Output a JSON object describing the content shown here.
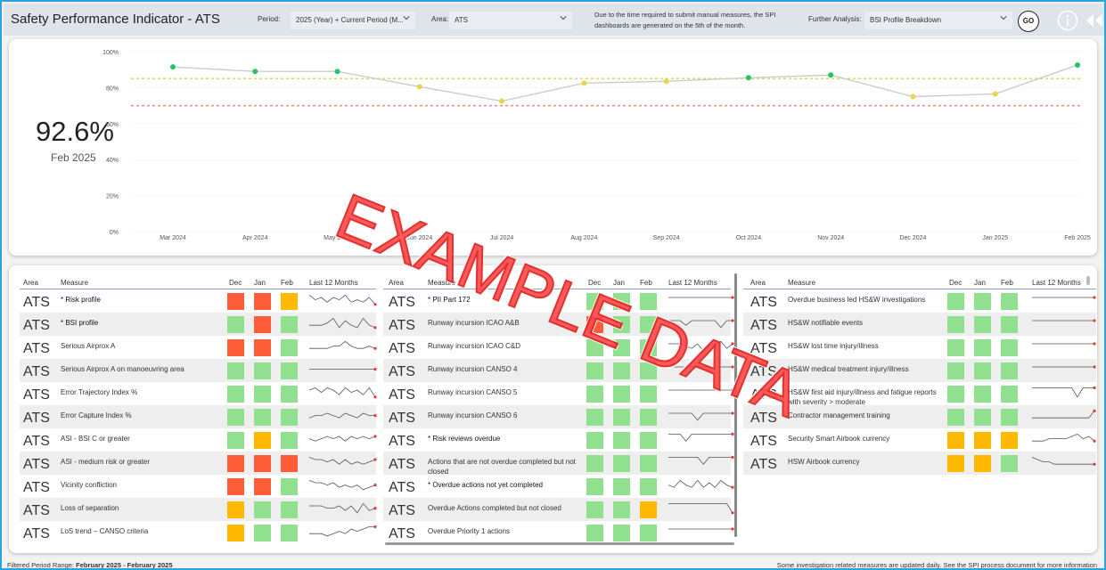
{
  "header": {
    "title": "Safety Performance Indicator  - ATS",
    "period_label": "Period:",
    "period_value": "2025 (Year) + Current Period (M...",
    "area_label": "Area:",
    "area_value": "ATS",
    "note": "Due to the time required to submit manual measures, the SPI dashboards are generated on the 5th of the month.",
    "further_label": "Further Analysis:",
    "further_value": "BSI Profile Breakdown",
    "go_label": "GO"
  },
  "kpi": {
    "value": "92.6%",
    "period": "Feb 2025"
  },
  "chart_data": {
    "type": "line",
    "categories": [
      "Mar 2024",
      "Apr 2024",
      "May 2024",
      "Jun 2024",
      "Jul 2024",
      "Aug 2024",
      "Sep 2024",
      "Oct 2024",
      "Nov 2024",
      "Dec 2024",
      "Jan 2025",
      "Feb 2025"
    ],
    "values": [
      91.5,
      89.0,
      89.0,
      80.5,
      72.5,
      82.5,
      83.5,
      85.5,
      87.0,
      75.0,
      76.5,
      92.6
    ],
    "point_colors": [
      "#22c55e",
      "#22c55e",
      "#22c55e",
      "#e8d44d",
      "#e8d44d",
      "#e8d44d",
      "#e8d44d",
      "#22c55e",
      "#22c55e",
      "#e8d44d",
      "#e8d44d",
      "#22c55e"
    ],
    "ylim": [
      0,
      100
    ],
    "yticks": [
      "0%",
      "20%",
      "40%",
      "60%",
      "80%",
      "100%"
    ],
    "target_lines": [
      {
        "value": 85,
        "color": "#d6d95a"
      },
      {
        "value": 70,
        "color": "#f08a7a"
      }
    ],
    "grid": true
  },
  "table_headers": {
    "area": "Area",
    "measure": "Measure",
    "dec": "Dec",
    "jan": "Jan",
    "feb": "Feb",
    "last12": "Last 12 Months"
  },
  "colors": {
    "green": "#90e090",
    "red": "#ff5c3a",
    "amber": "#ffba00"
  },
  "table1": [
    {
      "area": "ATS",
      "measure": "* Risk profile",
      "bold": true,
      "cells": [
        "red",
        "red",
        "amber"
      ],
      "spark": [
        6,
        4,
        5,
        3,
        5,
        4,
        6,
        3,
        4,
        3,
        5,
        2
      ]
    },
    {
      "area": "ATS",
      "measure": "* BSI profile",
      "bold": true,
      "cells": [
        "green",
        "red",
        "green"
      ],
      "spark": [
        3,
        3,
        3,
        4,
        6,
        2,
        5,
        3,
        2,
        6,
        3,
        2
      ]
    },
    {
      "area": "ATS",
      "measure": "Serious Airprox A",
      "bold": false,
      "cells": [
        "red",
        "red",
        "green"
      ],
      "spark": [
        3,
        3,
        3,
        3,
        4,
        4,
        6,
        4,
        3,
        3,
        4,
        3
      ]
    },
    {
      "area": "ATS",
      "measure": "Serious Airprox A on manoeuvring area",
      "bold": false,
      "cells": [
        "green",
        "green",
        "green"
      ],
      "spark": [
        4,
        4,
        4,
        4,
        4,
        4,
        4,
        4,
        4,
        4,
        4,
        4
      ]
    },
    {
      "area": "ATS",
      "measure": "Error Trajectory Index %",
      "bold": false,
      "cells": [
        "green",
        "green",
        "green"
      ],
      "spark": [
        5,
        6,
        4,
        6,
        5,
        3,
        6,
        4,
        5,
        3,
        6,
        2
      ]
    },
    {
      "area": "ATS",
      "measure": "Error Capture Index %",
      "bold": false,
      "cells": [
        "green",
        "green",
        "green"
      ],
      "spark": [
        3,
        4,
        4,
        5,
        4,
        3,
        5,
        4,
        3,
        5,
        4,
        4
      ]
    },
    {
      "area": "ATS",
      "measure": "ASI - BSI C or greater",
      "bold": false,
      "cells": [
        "green",
        "amber",
        "green"
      ],
      "spark": [
        4,
        3,
        4,
        5,
        4,
        5,
        3,
        5,
        4,
        5,
        4,
        5
      ]
    },
    {
      "area": "ATS",
      "measure": "ASI - medium risk or greater",
      "bold": false,
      "cells": [
        "red",
        "red",
        "red"
      ],
      "spark": [
        6,
        5,
        5,
        4,
        5,
        3,
        5,
        3,
        4,
        3,
        4,
        5
      ]
    },
    {
      "area": "ATS",
      "measure": "Vicinity confliction",
      "bold": false,
      "cells": [
        "red",
        "red",
        "green"
      ],
      "spark": [
        6,
        5,
        5,
        4,
        5,
        3,
        4,
        3,
        4,
        2,
        3,
        4
      ]
    },
    {
      "area": "ATS",
      "measure": "Loss of separation",
      "bold": false,
      "cells": [
        "amber",
        "green",
        "green"
      ],
      "spark": [
        5,
        5,
        5,
        4,
        4,
        5,
        3,
        5,
        2,
        6,
        3,
        4
      ]
    },
    {
      "area": "ATS",
      "measure": "LoS trend – CANSO criteria",
      "bold": false,
      "cells": [
        "amber",
        "green",
        "green"
      ],
      "spark": [
        3,
        3,
        3,
        2,
        3,
        4,
        3,
        5,
        4,
        5,
        6,
        6
      ]
    }
  ],
  "table2": [
    {
      "area": "ATS",
      "measure": "* PII Part 172",
      "bold": true,
      "cells": [
        "green",
        "green",
        "green"
      ],
      "spark": [
        5,
        5,
        5,
        5,
        5,
        5,
        5,
        5,
        5,
        5,
        5,
        5
      ]
    },
    {
      "area": "ATS",
      "measure": "Runway incursion ICAO A&B",
      "bold": false,
      "cells": [
        "red",
        "green",
        "green"
      ],
      "spark": [
        5,
        5,
        5,
        3,
        5,
        5,
        5,
        5,
        5,
        2,
        5,
        5
      ]
    },
    {
      "area": "ATS",
      "measure": "Runway incursion ICAO C&D",
      "bold": false,
      "cells": [
        "green",
        "green",
        "green"
      ],
      "spark": [
        5,
        5,
        5,
        4,
        3,
        5,
        2,
        4,
        5,
        6,
        3,
        5
      ]
    },
    {
      "area": "ATS",
      "measure": "Runway incursion CANSO 4",
      "bold": false,
      "cells": [
        "green",
        "green",
        "green"
      ],
      "spark": [
        5,
        5,
        5,
        5,
        5,
        5,
        5,
        5,
        5,
        5,
        5,
        5
      ]
    },
    {
      "area": "ATS",
      "measure": "Runway incursion CANSO 5",
      "bold": false,
      "cells": [
        "green",
        "green",
        "green"
      ],
      "spark": [
        5,
        5,
        5,
        5,
        5,
        5,
        5,
        5,
        5,
        5,
        5,
        5
      ]
    },
    {
      "area": "ATS",
      "measure": "Runway incursion CANSO 6",
      "bold": false,
      "cells": [
        "green",
        "green",
        "green"
      ],
      "spark": [
        5,
        5,
        5,
        5,
        5,
        2,
        5,
        5,
        5,
        5,
        5,
        5
      ]
    },
    {
      "area": "ATS",
      "measure": "* Risk reviews overdue",
      "bold": true,
      "cells": [
        "green",
        "green",
        "green"
      ],
      "spark": [
        6,
        6,
        6,
        3,
        6,
        6,
        6,
        6,
        6,
        6,
        6,
        6
      ]
    },
    {
      "area": "ATS",
      "measure": "Actions that are not overdue completed but not closed",
      "bold": false,
      "cells": [
        "green",
        "green",
        "green"
      ],
      "spark": [
        6,
        6,
        6,
        6,
        6,
        6,
        3,
        6,
        6,
        6,
        6,
        6
      ]
    },
    {
      "area": "ATS",
      "measure": "* Overdue actions not yet completed",
      "bold": true,
      "cells": [
        "green",
        "green",
        "green"
      ],
      "spark": [
        4,
        3,
        6,
        4,
        3,
        6,
        3,
        5,
        3,
        6,
        4,
        3
      ]
    },
    {
      "area": "ATS",
      "measure": "Overdue Actions completed but not closed",
      "bold": false,
      "cells": [
        "green",
        "green",
        "amber"
      ],
      "spark": [
        6,
        6,
        6,
        6,
        6,
        6,
        6,
        6,
        6,
        6,
        6,
        2
      ]
    },
    {
      "area": "ATS",
      "measure": "Overdue Priority 1 actions",
      "bold": false,
      "cells": [
        "green",
        "green",
        "green"
      ],
      "spark": [
        5,
        5,
        5,
        5,
        5,
        5,
        5,
        5,
        5,
        5,
        5,
        5
      ]
    }
  ],
  "table3": [
    {
      "area": "ATS",
      "measure": "Overdue business led HS&W investigations",
      "bold": false,
      "cells": [
        "green",
        "green",
        "green"
      ],
      "spark": [
        5,
        5,
        5,
        5,
        5,
        5,
        5,
        5,
        5,
        5,
        5,
        5
      ]
    },
    {
      "area": "ATS",
      "measure": "HS&W notifiable events",
      "bold": false,
      "cells": [
        "green",
        "green",
        "green"
      ],
      "spark": [
        5,
        5,
        5,
        5,
        5,
        5,
        5,
        5,
        5,
        5,
        5,
        5
      ]
    },
    {
      "area": "ATS",
      "measure": "HS&W lost time injury/illness",
      "bold": false,
      "cells": [
        "green",
        "green",
        "green"
      ],
      "spark": [
        5,
        5,
        5,
        5,
        5,
        5,
        5,
        5,
        5,
        5,
        5,
        5
      ]
    },
    {
      "area": "ATS",
      "measure": "HS&W medical treatment injury/illness",
      "bold": false,
      "cells": [
        "green",
        "green",
        "green"
      ],
      "spark": [
        5,
        5,
        5,
        5,
        5,
        5,
        5,
        5,
        5,
        5,
        5,
        5
      ]
    },
    {
      "area": "ATS",
      "measure": "HS&W first aid injury/illness and fatigue reports with severity > moderate",
      "bold": false,
      "cells": [
        "green",
        "green",
        "green"
      ],
      "spark": [
        6,
        6,
        6,
        6,
        6,
        6,
        6,
        6,
        2,
        6,
        6,
        6
      ]
    },
    {
      "area": "ATS",
      "measure": "Contractor management training",
      "bold": false,
      "cells": [
        "green",
        "green",
        "green"
      ],
      "spark": [
        3,
        3,
        3,
        3,
        3,
        3,
        3,
        3,
        3,
        3,
        3,
        6
      ]
    },
    {
      "area": "ATS",
      "measure": "Security Smart Airbook currency",
      "bold": false,
      "cells": [
        "amber",
        "amber",
        "amber"
      ],
      "spark": [
        3,
        3,
        3,
        4,
        4,
        4,
        4,
        5,
        6,
        4,
        5,
        3
      ]
    },
    {
      "area": "ATS",
      "measure": "HSW Airbook currency",
      "bold": false,
      "cells": [
        "amber",
        "amber",
        "green"
      ],
      "spark": [
        6,
        5,
        4,
        4,
        3,
        3,
        3,
        3,
        3,
        3,
        3,
        3
      ]
    }
  ],
  "watermark": "EXAMPLE DATA",
  "footer": {
    "range_label": "Filtered Period Range: ",
    "range_value": "February 2025 - February 2025",
    "note": "Some investigation related measures are updated daily. See the SPI process document for more information"
  }
}
